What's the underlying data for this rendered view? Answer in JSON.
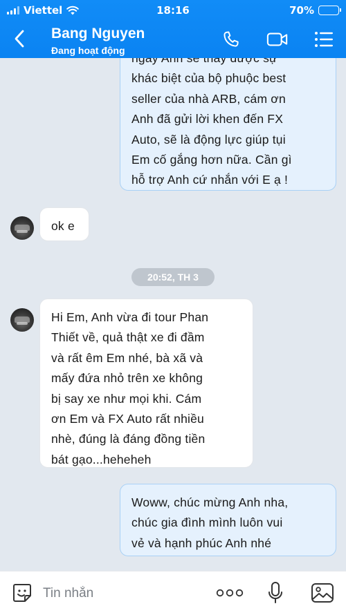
{
  "status_bar": {
    "carrier": "Viettel",
    "time": "18:16",
    "battery": "70%",
    "battery_level": 0.7
  },
  "header": {
    "name": "Bang Nguyen",
    "status": "Đang hoạt động"
  },
  "messages": [
    {
      "type": "outgoing",
      "lines": [
        "ngày Anh sẽ thấy được sự",
        "khác biệt của bộ phuộc best",
        "seller của nhà ARB, cám ơn",
        "Anh đã gửi lời khen đến FX",
        "Auto, sẽ là động lực giúp tụi",
        "Em cố gắng hơn nữa. Cần gì",
        "hỗ trợ Anh cứ nhắn với E ạ !"
      ]
    },
    {
      "type": "incoming",
      "lines": [
        "ok e"
      ]
    },
    {
      "type": "timestamp",
      "text": "20:52, TH 3"
    },
    {
      "type": "incoming",
      "lines": [
        "Hi Em, Anh vừa đi tour Phan",
        "Thiết về, quả thật xe đi đầm",
        "và rất êm Em nhé, bà xã và",
        "mấy đứa nhỏ trên xe không",
        "bị say xe như mọi khi. Cám",
        "ơn Em và FX Auto rất nhiều",
        "nhè, đúng là đáng đồng tiền",
        "bát gạo...heheheh"
      ]
    },
    {
      "type": "outgoing",
      "lines": [
        "Woww, chúc mừng Anh nha,",
        "chúc gia đình mình luôn vui",
        "vẻ và hạnh phúc Anh nhé"
      ]
    }
  ],
  "input": {
    "placeholder": "Tin nhắn"
  },
  "icons": {
    "back": "chevron-left-icon",
    "call": "phone-icon",
    "video": "video-camera-icon",
    "menu": "list-menu-icon",
    "sticker": "sticker-face-icon",
    "more": "more-dots-icon",
    "mic": "microphone-icon",
    "image": "image-icon"
  },
  "colors": {
    "header": "#0a83f2",
    "outgoing_bubble": "#e5f1fd",
    "incoming_bubble": "#ffffff",
    "background": "#e2e8ef",
    "timestamp_pill": "#bfc6ce"
  }
}
